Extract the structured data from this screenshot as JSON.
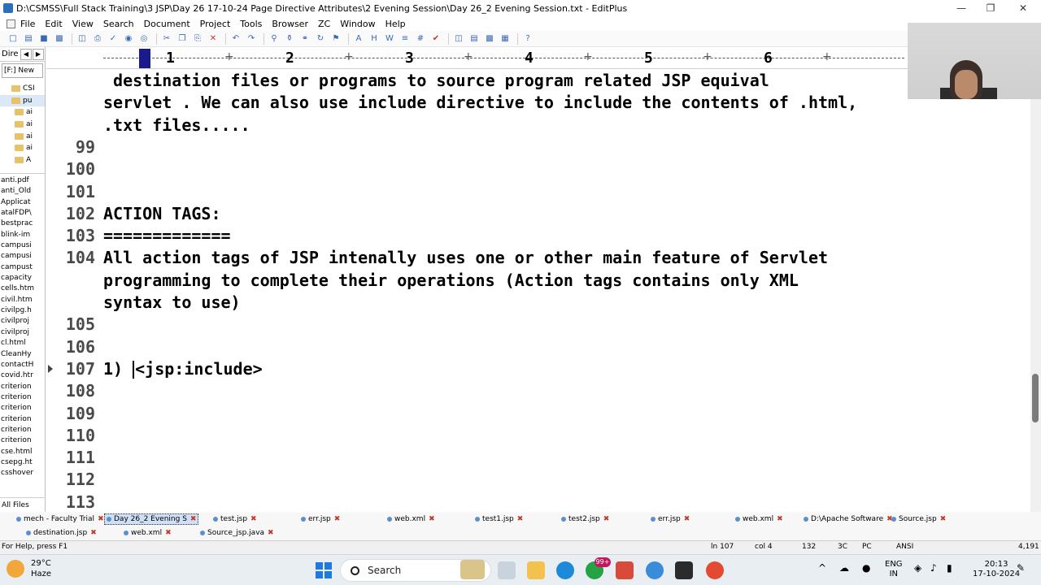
{
  "window": {
    "title": "D:\\CSMSS\\Full Stack Training\\3 JSP\\Day 26 17-10-24 Page Directive Attributes\\2 Evening Session\\Day 26_2 Evening Session.txt - EditPlus"
  },
  "menu": [
    "File",
    "Edit",
    "View",
    "Search",
    "Document",
    "Project",
    "Tools",
    "Browser",
    "ZC",
    "Window",
    "Help"
  ],
  "left_panel": {
    "header": "Dire",
    "drive": "[F:] New",
    "tree": [
      "CSI",
      "pu",
      "ai",
      "ai",
      "ai",
      "ai",
      "A"
    ],
    "files": [
      "anti.pdf",
      "anti_Old",
      "Applicat",
      "atalFDP\\",
      "bestprac",
      "blink-im",
      "campusi",
      "campusi",
      "campust",
      "capacity",
      "cells.htm",
      "civil.htm",
      "civilpg.h",
      "civilproj",
      "civilproj",
      "cl.html",
      "CleanHy",
      "contactH",
      "covid.htr",
      "criterion",
      "criterion",
      "criterion",
      "criterion",
      "criterion",
      "criterion",
      "cse.html",
      "csepg.ht",
      "csshover"
    ],
    "footer": "All Files"
  },
  "ruler": {
    "numbers": [
      "1",
      "2",
      "3",
      "4",
      "5",
      "6"
    ]
  },
  "editor": {
    "lines": [
      {
        "num": "",
        "text": " destination files or programs to source program related JSP equival"
      },
      {
        "num": "",
        "text": "servlet . We can also use include directive to include the contents of .html,"
      },
      {
        "num": "",
        "text": ".txt files....."
      },
      {
        "num": "99",
        "text": ""
      },
      {
        "num": "100",
        "text": ""
      },
      {
        "num": "101",
        "text": ""
      },
      {
        "num": "102",
        "text": "ACTION TAGS:"
      },
      {
        "num": "103",
        "text": "============="
      },
      {
        "num": "104",
        "text": "All action tags of JSP intenally uses one or other main feature of Servlet"
      },
      {
        "num": "",
        "text": "programming to complete their operations (Action tags contains only XML"
      },
      {
        "num": "",
        "text": "syntax to use)"
      },
      {
        "num": "105",
        "text": ""
      },
      {
        "num": "106",
        "text": ""
      },
      {
        "num": "107",
        "text": "1)",
        "after_caret": "<jsp:include>"
      },
      {
        "num": "108",
        "text": ""
      },
      {
        "num": "109",
        "text": ""
      },
      {
        "num": "110",
        "text": ""
      },
      {
        "num": "111",
        "text": ""
      },
      {
        "num": "112",
        "text": ""
      },
      {
        "num": "113",
        "text": ""
      }
    ]
  },
  "tabs_row1": [
    "mech - Faculty Trial",
    "Day 26_2 Evening S",
    "test.jsp",
    "err.jsp",
    "web.xml",
    "test1.jsp",
    "test2.jsp",
    "err.jsp",
    "web.xml",
    "D:\\Apache Software",
    "Source.jsp"
  ],
  "tabs_row2": [
    "destination.jsp",
    "web.xml",
    "Source_jsp.java"
  ],
  "status": {
    "help": "For Help, press F1",
    "line": "ln 107",
    "col": "col 4",
    "chars": "132",
    "mode": "3C",
    "os": "PC",
    "enc": "ANSI",
    "size": "4,191"
  },
  "taskbar": {
    "temp": "29°C",
    "weather": "Haze",
    "search": "Search",
    "badge": "99+",
    "lang1": "ENG",
    "lang2": "IN",
    "time": "20:13",
    "date": "17-10-2024"
  }
}
